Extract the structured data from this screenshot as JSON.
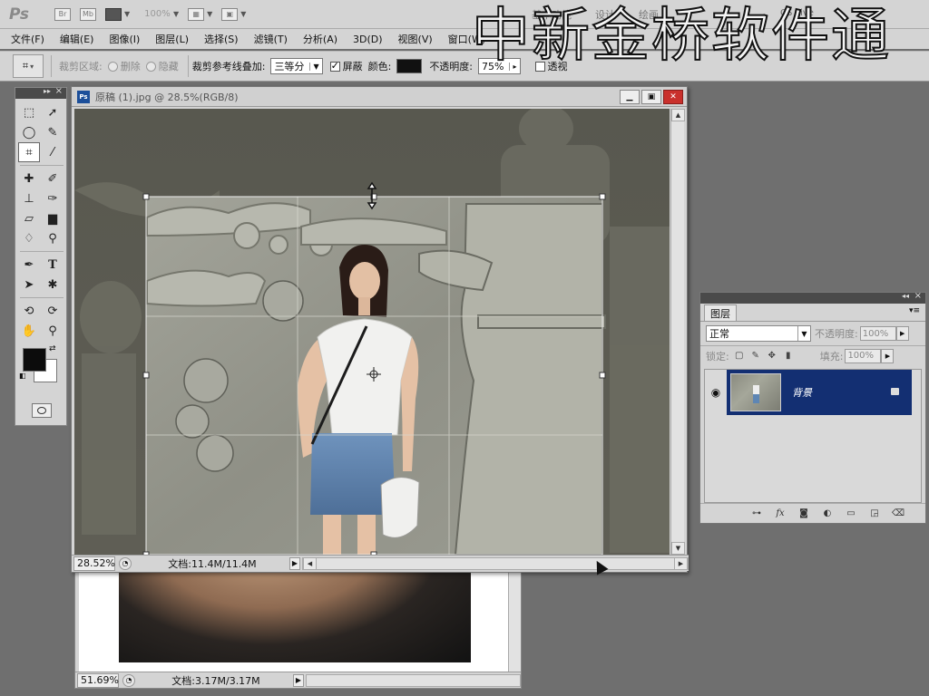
{
  "appbar": {
    "logo": "Ps",
    "zoom": "100%",
    "workspace_labels": [
      "基本功能",
      "设计",
      "绘画"
    ],
    "cs_live": "CS Live"
  },
  "watermark": "中新金桥软件通",
  "menu": {
    "items": [
      "文件(F)",
      "编辑(E)",
      "图像(I)",
      "图层(L)",
      "选择(S)",
      "滤镜(T)",
      "分析(A)",
      "3D(D)",
      "视图(V)",
      "窗口(W)"
    ]
  },
  "options": {
    "crop_area_label": "裁剪区域:",
    "delete_label": "删除",
    "hide_label": "隐藏",
    "overlay_label": "裁剪参考线叠加:",
    "overlay_value": "三等分",
    "shield_label": "屏蔽",
    "color_label": "颜色:",
    "opacity_label": "不透明度:",
    "opacity_value": "75%",
    "perspective_label": "透视"
  },
  "doc1": {
    "title": "原稿 (1).jpg @ 28.5%(RGB/8)",
    "zoom": "28.52%",
    "doc_info": "文档:11.4M/11.4M"
  },
  "doc2": {
    "zoom": "51.69%",
    "doc_info": "文档:3.17M/3.17M"
  },
  "layers": {
    "tab": "图层",
    "blend_mode": "正常",
    "opacity_label": "不透明度:",
    "opacity_value": "100%",
    "lock_label": "锁定:",
    "fill_label": "填充:",
    "fill_value": "100%",
    "layer_name": "背景"
  },
  "colors": {
    "accent_selected": "#132f72",
    "foreground": "#0c0c0c",
    "background": "#ffffff"
  }
}
